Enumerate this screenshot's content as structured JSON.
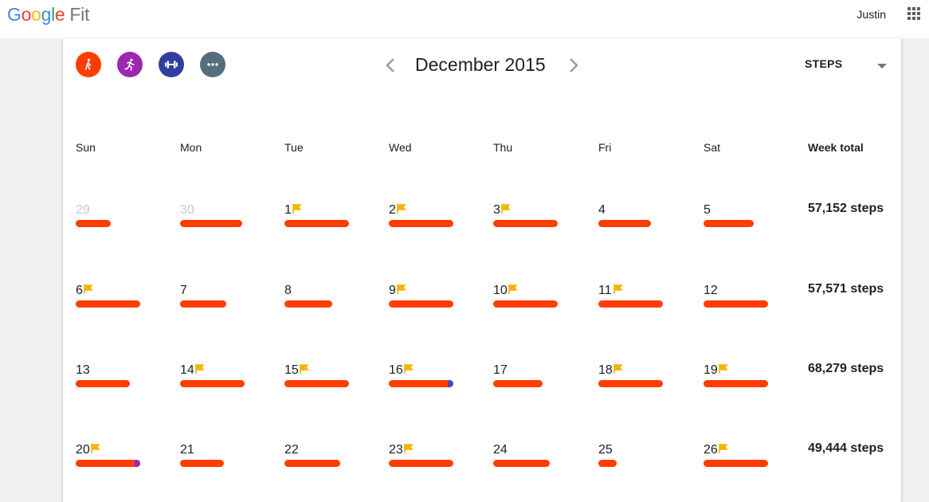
{
  "header": {
    "logo_letters": [
      {
        "char": "G",
        "color": "#4285F4"
      },
      {
        "char": "o",
        "color": "#EA4335"
      },
      {
        "char": "o",
        "color": "#FBBC05"
      },
      {
        "char": "g",
        "color": "#4285F4"
      },
      {
        "char": "l",
        "color": "#34A853"
      },
      {
        "char": "e",
        "color": "#EA4335"
      }
    ],
    "product": "Fit",
    "user": "Justin",
    "apps_icon": "apps-grid-icon"
  },
  "activity_filters": [
    {
      "name": "walking-icon",
      "color": "#FF3D00"
    },
    {
      "name": "running-icon",
      "color": "#9C27B0"
    },
    {
      "name": "strength-icon",
      "color": "#303F9F"
    },
    {
      "name": "more-icon",
      "color": "#546E7A"
    }
  ],
  "calendar": {
    "month": "December 2015",
    "metric": "STEPS",
    "days": [
      "Sun",
      "Mon",
      "Tue",
      "Wed",
      "Thu",
      "Fri",
      "Sat"
    ],
    "week_total_label": "Week total",
    "colors": {
      "bar": "#FF3D00",
      "flag": "#F4B400",
      "dim": "#C8C8C8",
      "cap_blue": "#3F51B5",
      "cap_purple": "#9C27B0"
    },
    "weeks": [
      {
        "total": "57,152 steps",
        "days": [
          {
            "day": "29",
            "dim": true,
            "bar": 0.54
          },
          {
            "day": "30",
            "dim": true,
            "bar": 0.96
          },
          {
            "day": "1",
            "goal": true,
            "bar": 1.0
          },
          {
            "day": "2",
            "goal": true,
            "bar": 1.0
          },
          {
            "day": "3",
            "goal": true,
            "bar": 1.0
          },
          {
            "day": "4",
            "bar": 0.82
          },
          {
            "day": "5",
            "bar": 0.78
          }
        ]
      },
      {
        "total": "57,571 steps",
        "days": [
          {
            "day": "6",
            "goal": true,
            "bar": 1.0
          },
          {
            "day": "7",
            "bar": 0.72
          },
          {
            "day": "8",
            "bar": 0.74
          },
          {
            "day": "9",
            "goal": true,
            "bar": 1.0
          },
          {
            "day": "10",
            "goal": true,
            "bar": 1.0
          },
          {
            "day": "11",
            "goal": true,
            "bar": 1.0
          },
          {
            "day": "12",
            "bar": 1.0
          }
        ]
      },
      {
        "total": "68,279 steps",
        "days": [
          {
            "day": "13",
            "bar": 0.84
          },
          {
            "day": "14",
            "goal": true,
            "bar": 1.0
          },
          {
            "day": "15",
            "goal": true,
            "bar": 1.0
          },
          {
            "day": "16",
            "goal": true,
            "bar": 1.0,
            "cap": "blue"
          },
          {
            "day": "17",
            "bar": 0.76
          },
          {
            "day": "18",
            "goal": true,
            "bar": 1.0
          },
          {
            "day": "19",
            "goal": true,
            "bar": 1.0
          }
        ]
      },
      {
        "total": "49,444 steps",
        "days": [
          {
            "day": "20",
            "goal": true,
            "bar": 1.0,
            "cap": "purple"
          },
          {
            "day": "21",
            "bar": 0.68
          },
          {
            "day": "22",
            "bar": 0.86
          },
          {
            "day": "23",
            "goal": true,
            "bar": 1.0
          },
          {
            "day": "24",
            "bar": 0.88
          },
          {
            "day": "25",
            "bar": 0.29
          },
          {
            "day": "26",
            "goal": true,
            "bar": 1.0
          }
        ]
      }
    ]
  }
}
